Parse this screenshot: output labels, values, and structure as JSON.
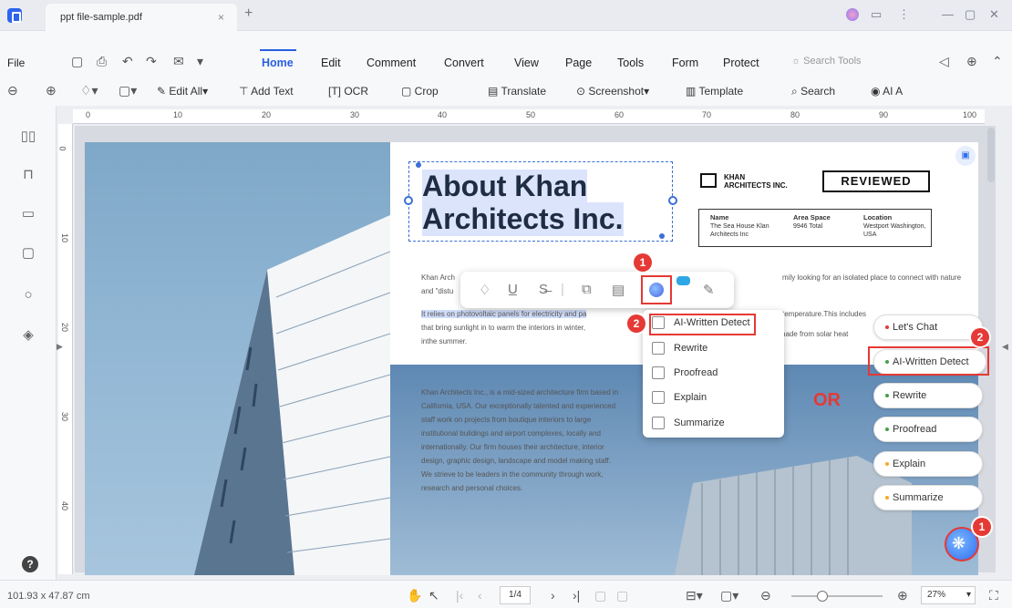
{
  "titlebar": {
    "tab_title": "ppt file-sample.pdf",
    "close_tab": "×",
    "new_tab": "+",
    "min": "—",
    "max": "▢",
    "close": "✕"
  },
  "menu": {
    "file": "File",
    "tabs": [
      "Home",
      "Edit",
      "Comment",
      "Convert",
      "View",
      "Page",
      "Tools",
      "Form",
      "Protect"
    ],
    "search_tools": "Search Tools"
  },
  "toolbar": {
    "edit_all": "Edit All",
    "add_text": "Add Text",
    "ocr": "OCR",
    "crop": "Crop",
    "translate": "Translate",
    "screenshot": "Screenshot",
    "template": "Template",
    "search": "Search",
    "ai": "AI A"
  },
  "ruler": {
    "h_ticks": [
      "0",
      "10",
      "20",
      "30",
      "40",
      "50",
      "60",
      "70",
      "80",
      "90",
      "100"
    ],
    "v_ticks": [
      "0",
      "10",
      "20",
      "30",
      "40"
    ]
  },
  "doc": {
    "heading_line1": "About Khan",
    "heading_line2": "Architects Inc.",
    "logo_line1": "KHAN",
    "logo_line2": "ARCHITECTS INC.",
    "reviewed": "REVIEWED",
    "table": {
      "name_h": "Name",
      "name_v": "The Sea House Klan Architects Inc",
      "area_h": "Area Space",
      "area_v": "9946 Total",
      "loc_h": "Location",
      "loc_v": "Westport Washington, USA"
    },
    "para1": "Khan Arch",
    "para1b": "mily looking for an isolated place to connect with nature",
    "para1c": "and \"distu",
    "para2a": "It relies on photovoltaic panels for electricity and pa",
    "para2b": "that bring sunlight in to warm the interiors in winter,",
    "para2c": "inthe summer.",
    "para2d": "temperature.This includes",
    "para2e": "shade from solar heat",
    "para3": "Khan Architects Inc., is a mid-sized architecture firm based in California, USA. Our exceptionally talented and experienced staff work on projects from boutique interiors to large institutional buildings and airport complexes, locally and internationally. Our firm houses their architecture, interior design, graphic design, landscape and model making staff. We strieve to be leaders in the community through work, research and personal choices."
  },
  "dropdown": {
    "items": [
      "AI-Written Detect",
      "Rewrite",
      "Proofread",
      "Explain",
      "Summarize"
    ]
  },
  "pills": {
    "items": [
      "Let's Chat",
      "AI-Written Detect",
      "Rewrite",
      "Proofread",
      "Explain",
      "Summarize"
    ],
    "dot_colors": [
      "#e53935",
      "#43a047",
      "#43a047",
      "#43a047",
      "#f9a825",
      "#f9a825"
    ]
  },
  "annotations": {
    "badge1": "1",
    "badge2": "2",
    "or": "OR"
  },
  "status": {
    "dims": "101.93 x 47.87 cm",
    "page": "1/4",
    "zoom": "27%"
  },
  "colors": {
    "accent": "#2a5fe0",
    "annotation": "#e53935"
  }
}
